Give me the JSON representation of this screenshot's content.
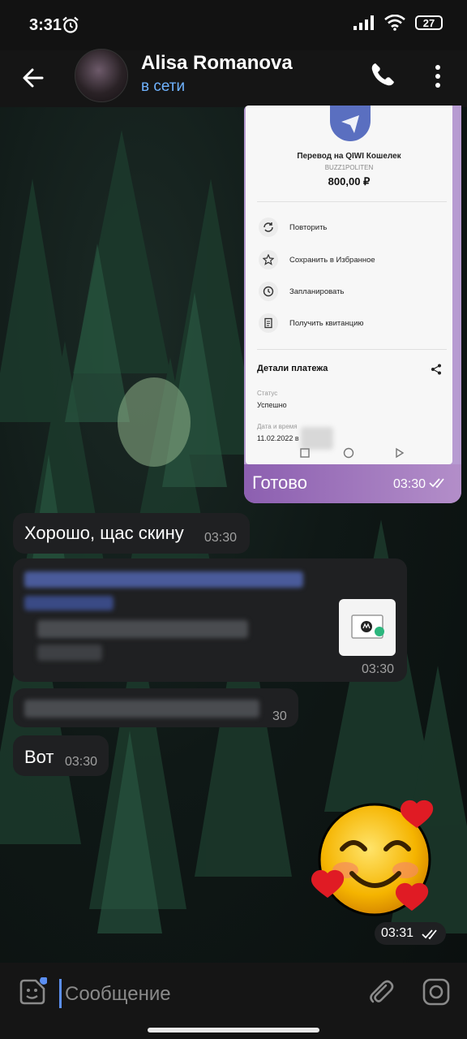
{
  "status_bar": {
    "time": "3:31",
    "battery": "27"
  },
  "header": {
    "name": "Alisa Romanova",
    "status": "в сети"
  },
  "screenshot": {
    "title": "Перевод на QIWI Кошелек",
    "subtitle": "BUZZ1POLITEN",
    "amount": "800,00 ₽",
    "actions": [
      {
        "label": "Повторить",
        "icon": "repeat-icon"
      },
      {
        "label": "Сохранить в Избранное",
        "icon": "star-icon"
      },
      {
        "label": "Запланировать",
        "icon": "clock-icon"
      },
      {
        "label": "Получить квитанцию",
        "icon": "receipt-icon"
      }
    ],
    "details_title": "Детали платежа",
    "status_label": "Статус",
    "status_value": "Успешно",
    "date_label": "Дата и время",
    "date_value": "11.02.2022 в"
  },
  "messages": [
    {
      "side": "out",
      "text": "Готово",
      "time": "03:30",
      "read": true
    },
    {
      "side": "in",
      "text": "Хорошо, щас скину",
      "time": "03:30"
    },
    {
      "side": "in",
      "text": "",
      "time": "03:30",
      "blurred": true,
      "link_preview": true
    },
    {
      "side": "in",
      "text": "",
      "time": "30",
      "blurred": true
    },
    {
      "side": "in",
      "text": "Вот",
      "time": "03:30"
    },
    {
      "side": "out",
      "sticker": "smiling-face-with-hearts",
      "time": "03:31",
      "read": true
    }
  ],
  "input": {
    "placeholder": "Сообщение"
  },
  "colors": {
    "accent": "#6fb3ff",
    "out_bubble": "#8c5fb0",
    "in_bubble": "#1f2022"
  }
}
